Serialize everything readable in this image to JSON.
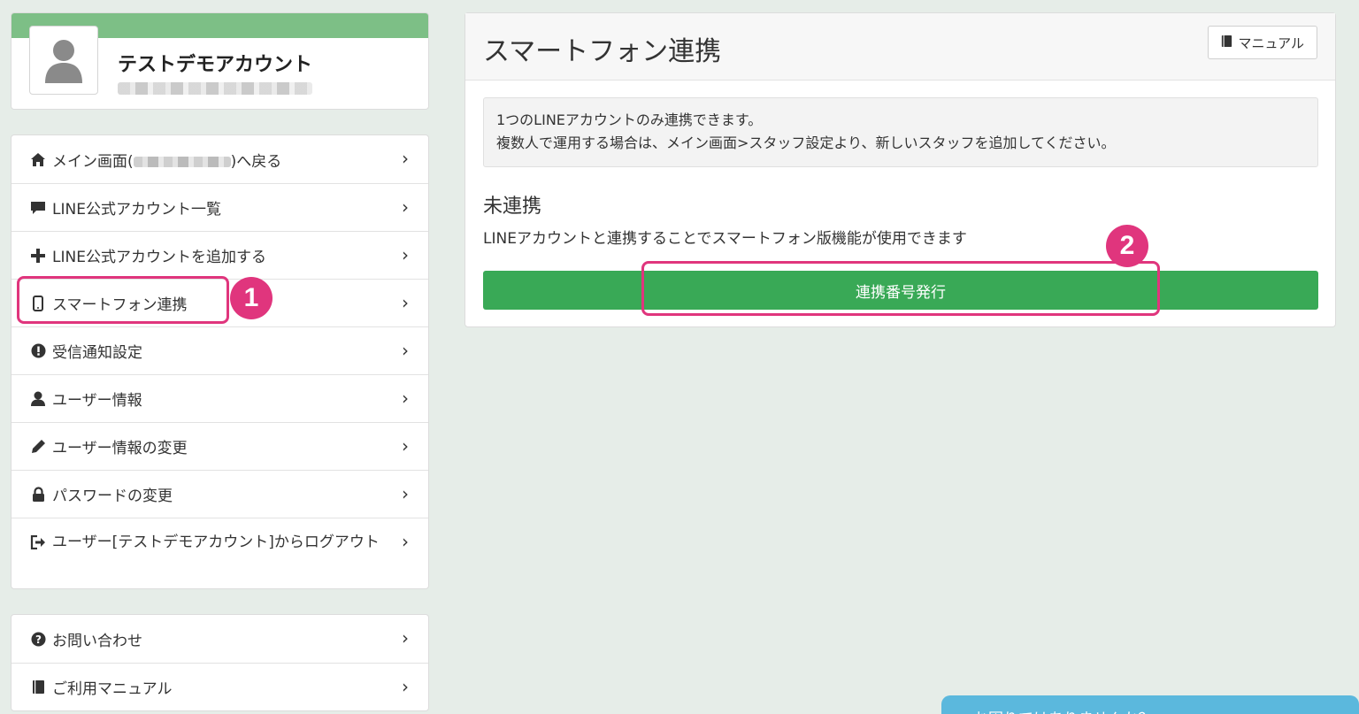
{
  "profile": {
    "name": "テストデモアカウント"
  },
  "menu": [
    {
      "icon": "home-icon",
      "pre": "メイン画面(",
      "post": ")へ戻る"
    },
    {
      "icon": "comment-icon",
      "label": "LINE公式アカウント一覧"
    },
    {
      "icon": "plus-icon",
      "label": "LINE公式アカウントを追加する"
    },
    {
      "icon": "mobile-icon",
      "label": "スマートフォン連携"
    },
    {
      "icon": "exclamation-circle-icon",
      "label": "受信通知設定"
    },
    {
      "icon": "user-icon",
      "label": "ユーザー情報"
    },
    {
      "icon": "pencil-icon",
      "label": "ユーザー情報の変更"
    },
    {
      "icon": "lock-icon",
      "label": "パスワードの変更"
    },
    {
      "icon": "logout-icon",
      "label": "ユーザー[テストデモアカウント]からログアウト"
    }
  ],
  "help_menu": [
    {
      "icon": "question-circle-icon",
      "label": "お問い合わせ"
    },
    {
      "icon": "book-icon",
      "label": "ご利用マニュアル"
    }
  ],
  "main": {
    "title": "スマートフォン連携",
    "manual_label": "マニュアル",
    "notice_line1": "1つのLINEアカウントのみ連携できます。",
    "notice_line2": "複数人で運用する場合は、メイン画面>スタッフ設定より、新しいスタッフを追加してください。",
    "status_title": "未連携",
    "status_desc": "LINEアカウントと連携することでスマートフォン版機能が使用できます",
    "issue_button": "連携番号発行"
  },
  "annotations": {
    "step1": "1",
    "step2": "2"
  },
  "help_tab": "お困りではありませんか？",
  "colors": {
    "accent_green": "#39a956",
    "header_band": "#7dbf86",
    "highlight": "#e0357d",
    "background": "#e6ede8"
  }
}
